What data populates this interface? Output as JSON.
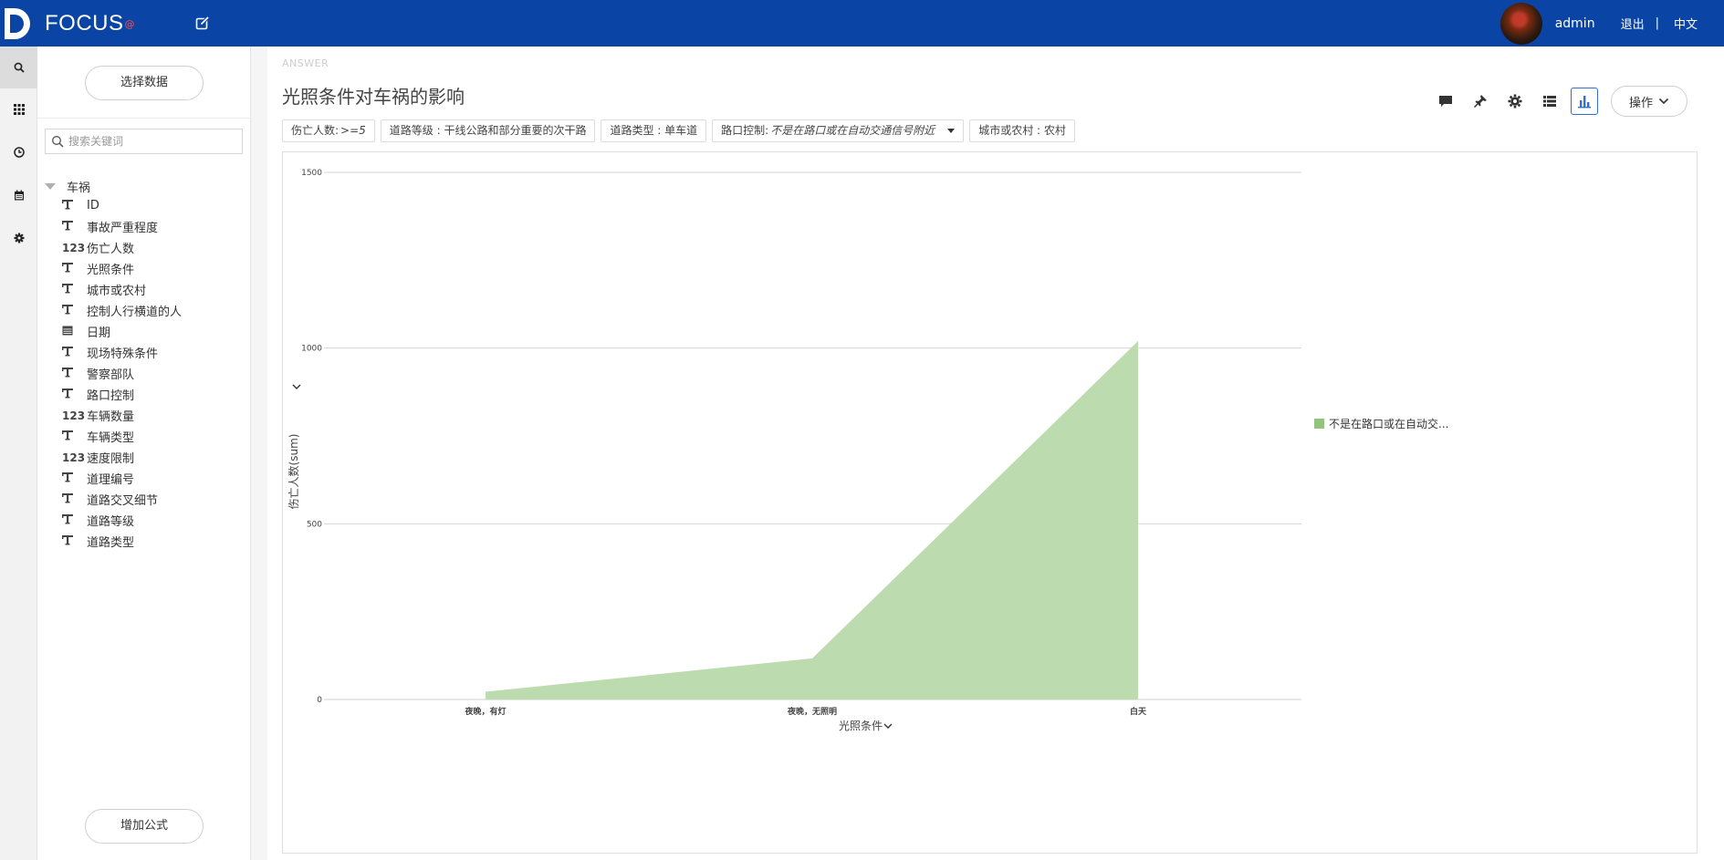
{
  "header": {
    "logo_text": "FOCUS",
    "logo_sup": "@",
    "user": "admin",
    "logout": "退出",
    "separator": "|",
    "language": "中文"
  },
  "rail": {
    "items": [
      {
        "icon": "search-icon",
        "active": true
      },
      {
        "icon": "grid-icon",
        "active": false
      },
      {
        "icon": "clock-icon",
        "active": false
      },
      {
        "icon": "calendar-icon",
        "active": false
      },
      {
        "icon": "gear-icon",
        "active": false
      }
    ]
  },
  "panel": {
    "select_data_label": "选择数据",
    "search_placeholder": "搜索关键词",
    "tree_root": "车祸",
    "fields": [
      {
        "type": "text",
        "type_label": "T",
        "label": "ID"
      },
      {
        "type": "text",
        "type_label": "T",
        "label": "事故严重程度"
      },
      {
        "type": "number",
        "type_label": "123",
        "label": "伤亡人数"
      },
      {
        "type": "text",
        "type_label": "T",
        "label": "光照条件"
      },
      {
        "type": "text",
        "type_label": "T",
        "label": "城市或农村"
      },
      {
        "type": "text",
        "type_label": "T",
        "label": "控制人行横道的人"
      },
      {
        "type": "date",
        "type_label": "",
        "label": "日期"
      },
      {
        "type": "text",
        "type_label": "T",
        "label": "现场特殊条件"
      },
      {
        "type": "text",
        "type_label": "T",
        "label": "警察部队"
      },
      {
        "type": "text",
        "type_label": "T",
        "label": "路口控制"
      },
      {
        "type": "number",
        "type_label": "123",
        "label": "车辆数量"
      },
      {
        "type": "text",
        "type_label": "T",
        "label": "车辆类型"
      },
      {
        "type": "number",
        "type_label": "123",
        "label": "速度限制"
      },
      {
        "type": "text",
        "type_label": "T",
        "label": "道理编号"
      },
      {
        "type": "text",
        "type_label": "T",
        "label": "道路交叉细节"
      },
      {
        "type": "text",
        "type_label": "T",
        "label": "道路等级"
      },
      {
        "type": "text",
        "type_label": "T",
        "label": "道路类型"
      }
    ],
    "add_formula_label": "增加公式"
  },
  "main": {
    "answer_tag": "ANSWER",
    "title": "光照条件对车祸的影响",
    "ops_label": "操作",
    "filters": [
      {
        "key": "伤亡人数: ",
        "value": ">=5",
        "italic": true,
        "dropdown": false
      },
      {
        "key": "道路等级 : 干线公路和部分重要的次干路",
        "value": "",
        "italic": false,
        "dropdown": false
      },
      {
        "key": "道路类型 : 单车道",
        "value": "",
        "italic": false,
        "dropdown": false
      },
      {
        "key": "路口控制: ",
        "value": "不是在路口或在自动交通信号附近",
        "italic": true,
        "dropdown": true
      },
      {
        "key": "城市或农村 : 农村",
        "value": "",
        "italic": false,
        "dropdown": false
      }
    ]
  },
  "chart_data": {
    "type": "area",
    "categories": [
      "夜晚，有灯",
      "夜晚，无照明",
      "白天"
    ],
    "series": [
      {
        "name": "不是在路口或在自动交...",
        "values": [
          22,
          117,
          1020
        ],
        "color": "#bcdcb0",
        "legend_color": "#93c47d"
      }
    ],
    "xlabel": "光照条件",
    "ylabel": "伤亡人数(sum)",
    "ylim": [
      0,
      1500
    ],
    "yticks": [
      0,
      500,
      1000,
      1500
    ],
    "grid": true,
    "legend_position": "right"
  }
}
